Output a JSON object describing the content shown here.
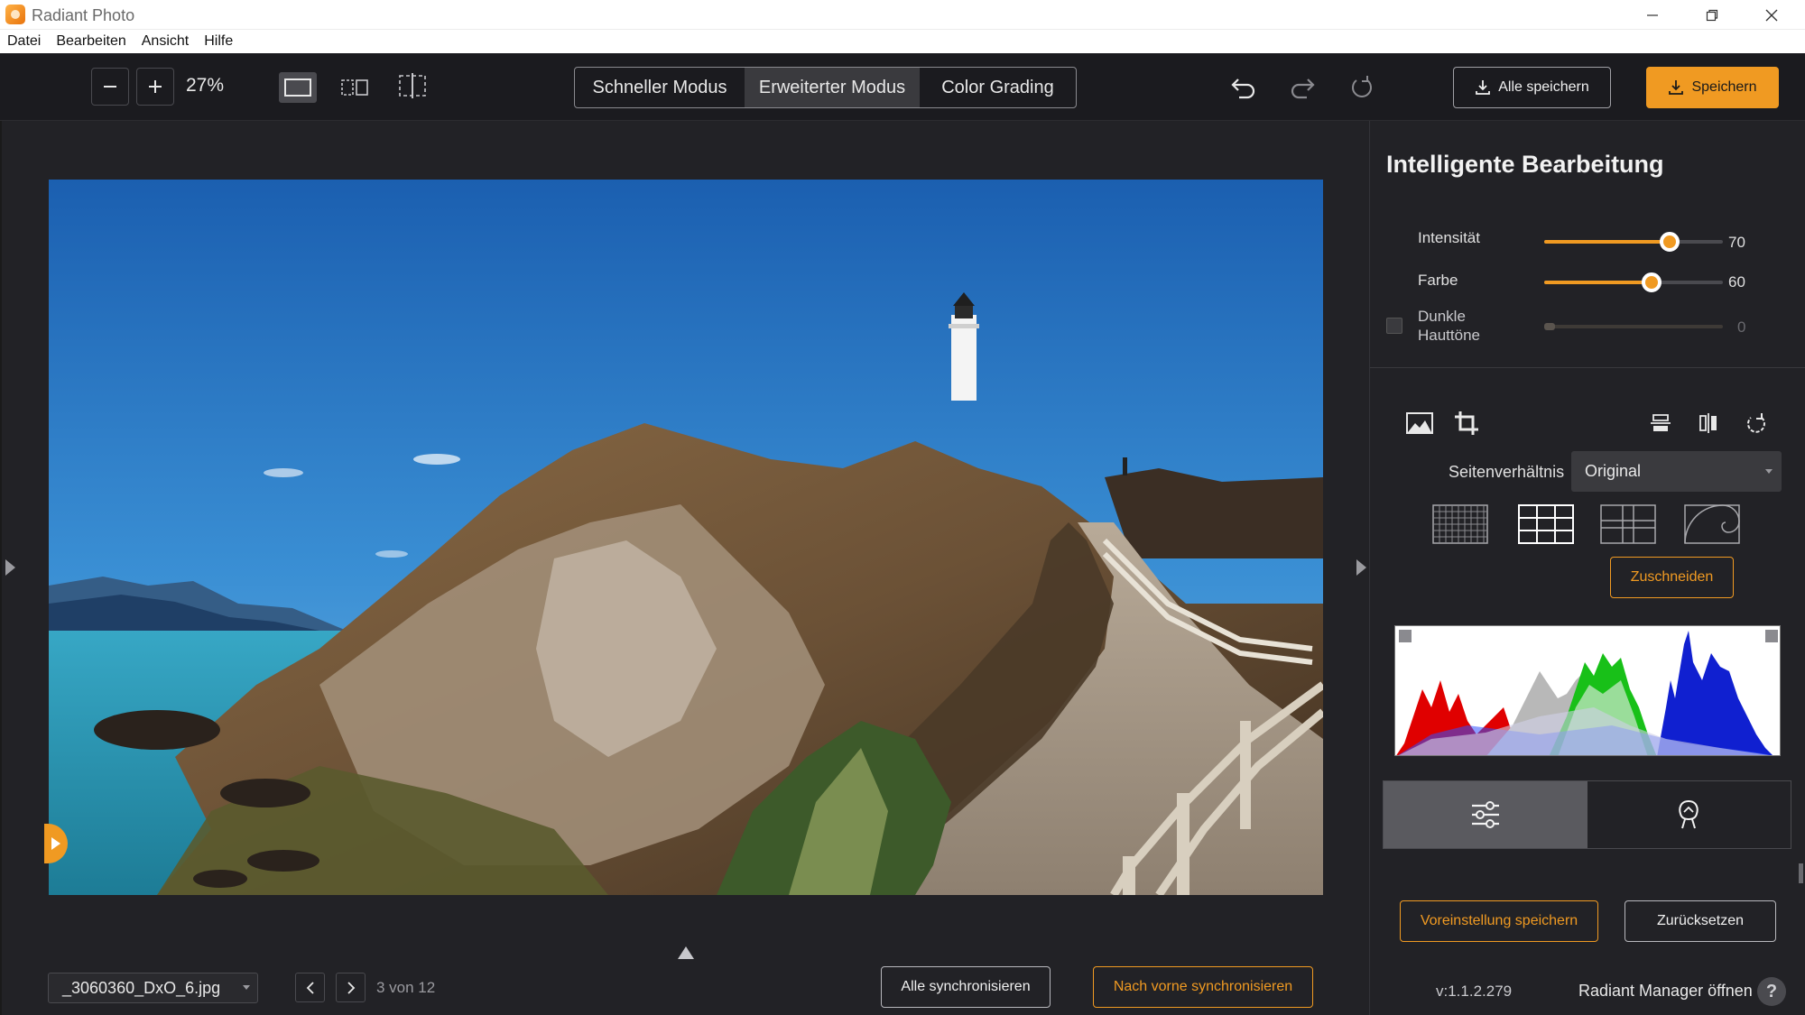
{
  "window": {
    "title": "Radiant Photo"
  },
  "menu": [
    "Datei",
    "Bearbeiten",
    "Ansicht",
    "Hilfe"
  ],
  "toolbar": {
    "zoom": "27%",
    "modes": [
      "Schneller Modus",
      "Erweiterter Modus",
      "Color Grading"
    ],
    "active_mode": "Erweiterter Modus",
    "save_all_label": "Alle speichern",
    "save_label": "Speichern"
  },
  "bottom": {
    "file_name": "_3060360_DxO_6.jpg",
    "page_counter": "3 von 12",
    "sync_all_label": "Alle synchronisieren",
    "sync_forward_label": "Nach vorne synchronisieren"
  },
  "panel": {
    "title": "Intelligente Bearbeitung",
    "sliders": [
      {
        "label": "Intensität",
        "value": "70",
        "fraction": 0.7
      },
      {
        "label": "Farbe",
        "value": "60",
        "fraction": 0.6
      },
      {
        "label_line1": "Dunkle",
        "label_line2": "Hauttöne",
        "value": "0",
        "fraction": 0.0,
        "checked": false
      }
    ],
    "aspect_label": "Seitenverhältnis",
    "aspect_value": "Original",
    "crop_label": "Zuschneiden",
    "save_preset_label": "Voreinstellung speichern",
    "reset_label": "Zurücksetzen",
    "version": "v:1.1.2.279",
    "manager_link": "Radiant Manager öffnen",
    "help_glyph": "?"
  },
  "colors": {
    "accent": "#f09a22",
    "bg": "#202024",
    "panel": "#222226"
  }
}
